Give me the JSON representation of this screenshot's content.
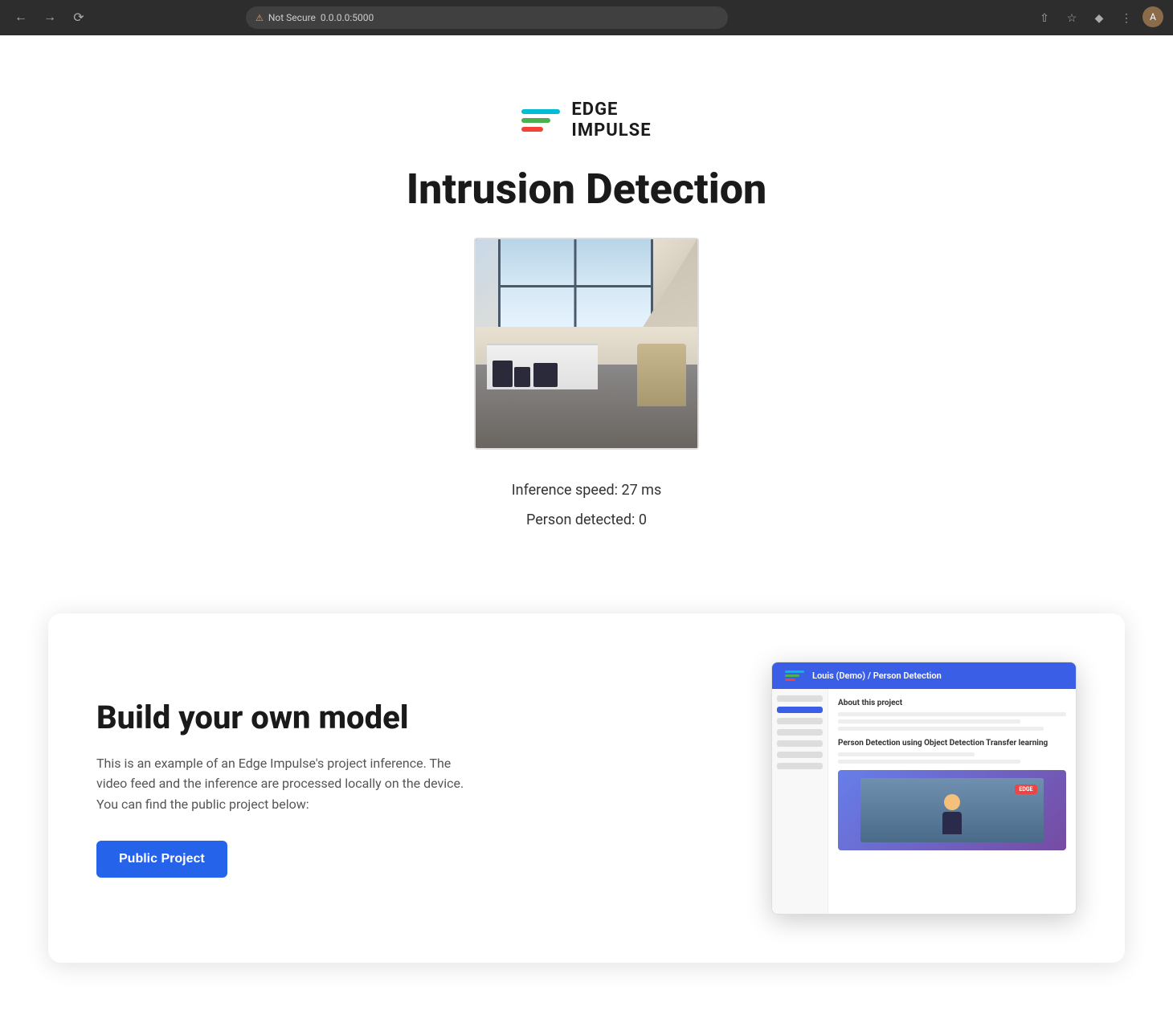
{
  "browser": {
    "url": "0.0.0.0:5000",
    "security_label": "Not Secure"
  },
  "logo": {
    "name": "EDGE IMPULSE",
    "line1": "EDGE",
    "line2": "IMPULSE"
  },
  "page": {
    "title": "Intrusion Detection",
    "inference_speed_label": "Inference speed: 27 ms",
    "person_detected_label": "Person detected: 0"
  },
  "info_card": {
    "title": "Build your own model",
    "description": "This is an example of an Edge Impulse's project inference. The video feed and the inference are processed locally on the device. You can find the public project below:",
    "button_label": "Public Project"
  },
  "preview": {
    "breadcrumb": "Louis (Demo) / Person Detection",
    "section_title": "About this project",
    "project_title": "Person Detection using Object Detection Transfer learning",
    "nested_title": "Louis (Demo) / Person Detection",
    "red_badge": "EDGE"
  }
}
